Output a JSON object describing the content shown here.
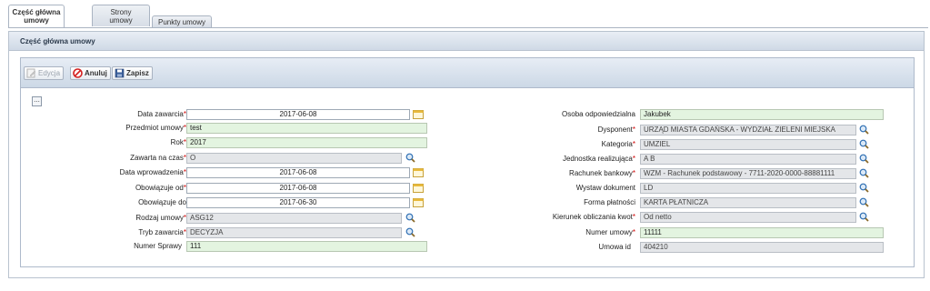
{
  "tabs": [
    {
      "label_line1": "Część główna",
      "label_line2": "umowy"
    },
    {
      "label_line1": "Strony",
      "label_line2": "umowy"
    },
    {
      "label_line1": "Punkty umowy",
      "label_line2": ""
    }
  ],
  "panel": {
    "title": "Część główna umowy"
  },
  "toolbar": {
    "edit": "Edycja",
    "cancel": "Anuluj",
    "save": "Zapisz"
  },
  "collapse_symbol": "...",
  "left": {
    "data_zawarcia": {
      "label": "Data zawarcia",
      "value": "2017-06-08"
    },
    "przedmiot": {
      "label": "Przedmiot umowy",
      "value": "test"
    },
    "rok": {
      "label": "Rok",
      "value": "2017"
    },
    "zawarta_na_czas": {
      "label": "Zawarta na czas",
      "value": "O"
    },
    "data_wprowadzenia": {
      "label": "Data wprowadzenia",
      "value": "2017-06-08"
    },
    "obowiazuje_od": {
      "label": "Obowiązuje od",
      "value": "2017-06-08"
    },
    "obowiazuje_do": {
      "label": "Obowiązuje do",
      "value": "2017-06-30"
    },
    "rodzaj_umowy": {
      "label": "Rodzaj umowy",
      "value": "ASG12"
    },
    "tryb_zawarcia": {
      "label": "Tryb zawarcia",
      "value": "DECYZJA"
    },
    "numer_sprawy": {
      "label": "Numer Sprawy",
      "value": "111"
    }
  },
  "right": {
    "osoba": {
      "label": "Osoba odpowiedzialna",
      "value": "Jakubek"
    },
    "dysponent": {
      "label": "Dysponent",
      "value": "URZĄD MIASTA GDAŃSKA - WYDZIAŁ ZIELENI MIEJSKA"
    },
    "kategoria": {
      "label": "Kategoria",
      "value": "UMZIEL"
    },
    "jednostka": {
      "label": "Jednostka realizująca",
      "value": "A  B"
    },
    "rachunek": {
      "label": "Rachunek bankowy",
      "value": "WZM - Rachunek podstawowy - 7711-2020-0000-88881111"
    },
    "wystaw": {
      "label": "Wystaw dokument",
      "value": " LD"
    },
    "forma": {
      "label": "Forma płatności",
      "value": "KARTA PŁATNICZA"
    },
    "kierunek": {
      "label": "Kierunek obliczania kwot",
      "value": "Od netto"
    },
    "numer_umowy": {
      "label": "Numer umowy",
      "value": "11111"
    },
    "umowa_id": {
      "label": "Umowa id",
      "value": "404210"
    }
  },
  "colors": {
    "required": "#d00000",
    "green_field": "#e3f4e0",
    "grey_field": "#e4e6e9"
  }
}
